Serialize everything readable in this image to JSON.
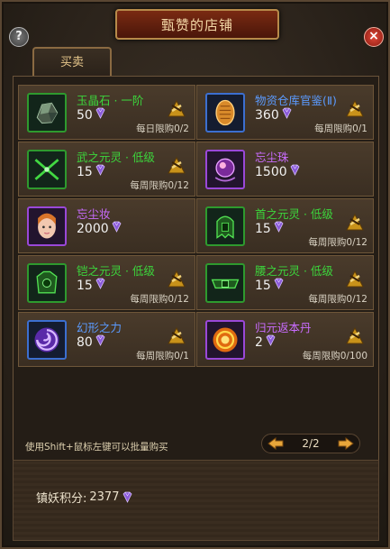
{
  "window": {
    "title": "甄赞的店铺",
    "help": "?",
    "close": "×"
  },
  "tabs": [
    {
      "label": "买卖"
    }
  ],
  "items": [
    {
      "name": "玉晶石 · 一阶",
      "price": "50",
      "limit": "每日限购0/2",
      "name_color": "green",
      "icon": "jade-stone-icon"
    },
    {
      "name": "物资仓库官鉴(Ⅱ)",
      "price": "360",
      "limit": "每周限购0/1",
      "name_color": "blue",
      "icon": "warehouse-token-icon"
    },
    {
      "name": "武之元灵 · 低级",
      "price": "15",
      "limit": "每周限购0/12",
      "name_color": "green",
      "icon": "weapon-spirit-icon"
    },
    {
      "name": "忘尘珠",
      "price": "1500",
      "limit": "",
      "name_color": "purple",
      "icon": "forget-dust-pearl-icon"
    },
    {
      "name": "忘尘妆",
      "price": "2000",
      "limit": "",
      "name_color": "purple",
      "icon": "forget-dust-makeup-icon"
    },
    {
      "name": "首之元灵 · 低级",
      "price": "15",
      "limit": "每周限购0/12",
      "name_color": "green",
      "icon": "head-spirit-icon"
    },
    {
      "name": "铠之元灵 · 低级",
      "price": "15",
      "limit": "每周限购0/12",
      "name_color": "green",
      "icon": "armor-spirit-icon"
    },
    {
      "name": "腰之元灵 · 低级",
      "price": "15",
      "limit": "每周限购0/12",
      "name_color": "green",
      "icon": "waist-spirit-icon"
    },
    {
      "name": "幻形之力",
      "price": "80",
      "limit": "每周限购0/1",
      "name_color": "blue",
      "icon": "illusion-power-icon"
    },
    {
      "name": "归元返本丹",
      "price": "2",
      "limit": "每周限购0/100",
      "name_color": "purple",
      "icon": "return-origin-pill-icon"
    }
  ],
  "footer": {
    "hint": "使用Shift+鼠标左键可以批量购买",
    "page": "2/2",
    "score_label": "镇妖积分:",
    "score_value": "2377"
  },
  "colors": {
    "green": "#3cd63c",
    "blue": "#5b9bff",
    "purple": "#c96cff"
  }
}
